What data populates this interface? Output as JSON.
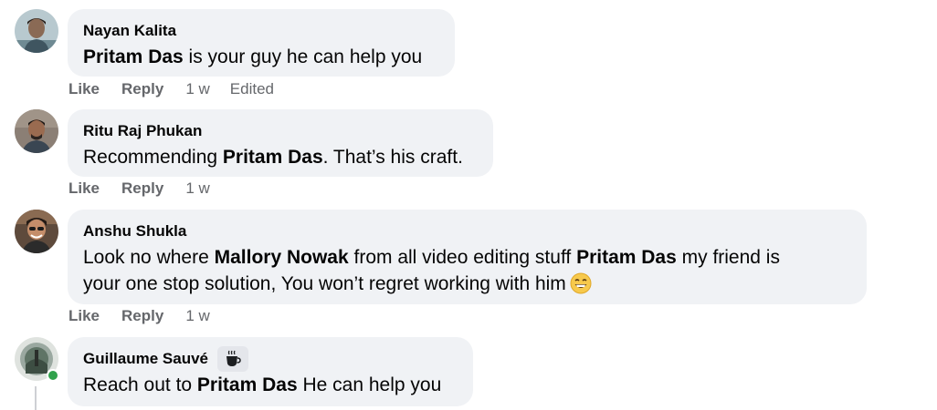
{
  "comments": [
    {
      "author": "Nayan Kalita",
      "text_parts": [
        "Pritam Das",
        " is your guy he can help you"
      ],
      "actions": {
        "like": "Like",
        "reply": "Reply",
        "time": "1 w",
        "edited": "Edited"
      }
    },
    {
      "author": "Ritu Raj Phukan",
      "text_parts": [
        "Recommending ",
        "Pritam Das",
        ". That’s his craft."
      ],
      "actions": {
        "like": "Like",
        "reply": "Reply",
        "time": "1 w"
      }
    },
    {
      "author": "Anshu Shukla",
      "line1_parts": [
        "Look no where ",
        "Mallory Nowak",
        " from all video editing stuff ",
        "Pritam Das",
        " my friend is"
      ],
      "line2": "your one stop solution, You won’t regret working with him",
      "emoji": "grinning-face",
      "actions": {
        "like": "Like",
        "reply": "Reply",
        "time": "1 w"
      }
    },
    {
      "author": "Guillaume Sauvé",
      "badge_icon": "coffee-cup-icon",
      "online": true,
      "text_parts": [
        "Reach out to ",
        "Pritam Das",
        " He can help you"
      ]
    }
  ],
  "colors": {
    "bubble": "#f0f2f5",
    "text": "#050505",
    "secondary": "#65676b",
    "online": "#31a24c"
  }
}
